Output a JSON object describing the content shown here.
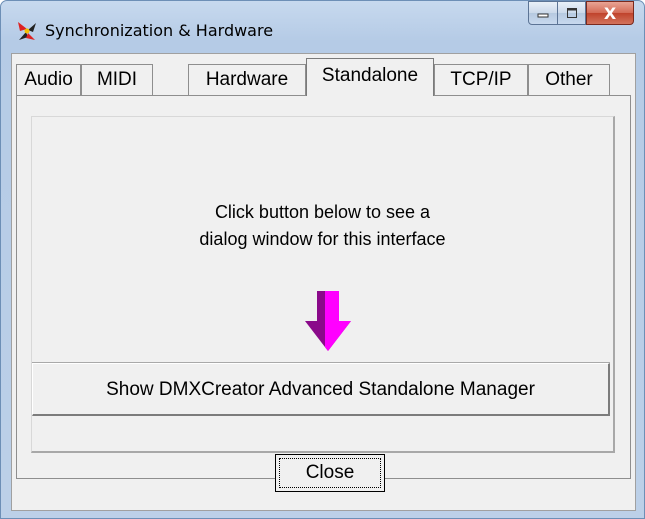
{
  "window": {
    "title": "Synchronization & Hardware",
    "close_glyph": "X"
  },
  "tabs": [
    {
      "label": "Audio",
      "active": false
    },
    {
      "label": "MIDI",
      "active": false
    },
    {
      "label": "Hardware",
      "active": false
    },
    {
      "label": "Standalone",
      "active": true
    },
    {
      "label": "TCP/IP",
      "active": false
    },
    {
      "label": "Other",
      "active": false
    }
  ],
  "panel": {
    "info_line1": "Click button below to see a",
    "info_line2": "dialog window for this interface",
    "arrow_color_top": "#cc00cc",
    "arrow_color_side": "#8a0a8a",
    "show_button_label": "Show DMXCreator Advanced  Standalone  Manager"
  },
  "footer": {
    "close_label": "Close"
  }
}
